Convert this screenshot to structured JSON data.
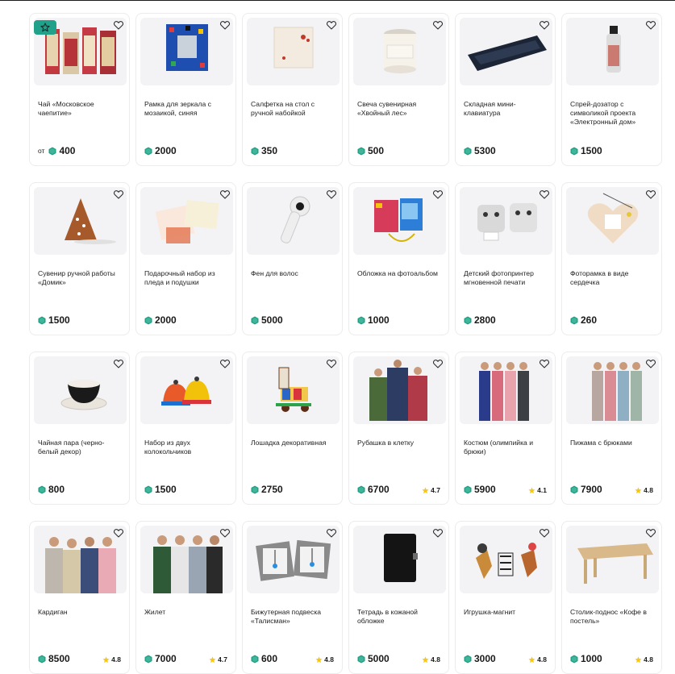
{
  "products": [
    {
      "name": "Чай «Московское чаепитие»",
      "from": "от",
      "price": "400",
      "rating": "",
      "featured": true,
      "image": "tea-boxes-image"
    },
    {
      "name": "Рамка для зеркала с мозаикой, синяя",
      "from": "",
      "price": "2000",
      "rating": "",
      "image": "mosaic-frame-image"
    },
    {
      "name": "Салфетка на стол с ручной набойкой",
      "from": "",
      "price": "350",
      "rating": "",
      "image": "napkin-image"
    },
    {
      "name": "Свеча сувенирная «Хвойный лес»",
      "from": "",
      "price": "500",
      "rating": "",
      "image": "candle-image"
    },
    {
      "name": "Складная мини-клавиатура",
      "from": "",
      "price": "5300",
      "rating": "",
      "image": "keyboard-image"
    },
    {
      "name": "Спрей-дозатор с символикой проекта «Электронный дом»",
      "from": "",
      "price": "1500",
      "rating": "",
      "image": "spray-bottle-image"
    },
    {
      "name": "Сувенир ручной работы «Домик»",
      "from": "",
      "price": "1500",
      "rating": "",
      "image": "house-souvenir-image"
    },
    {
      "name": "Подарочный набор из пледа и подушки",
      "from": "",
      "price": "2000",
      "rating": "",
      "image": "blanket-set-image"
    },
    {
      "name": "Фен для волос",
      "from": "",
      "price": "5000",
      "rating": "",
      "image": "hair-dryer-image"
    },
    {
      "name": "Обложка на фотоальбом",
      "from": "",
      "price": "1000",
      "rating": "",
      "image": "album-cover-image"
    },
    {
      "name": "Детский фотопринтер мгновенной печати",
      "from": "",
      "price": "2800",
      "rating": "",
      "image": "photo-printer-image"
    },
    {
      "name": "Фоторамка в виде сердечка",
      "from": "",
      "price": "260",
      "rating": "",
      "image": "heart-frame-image"
    },
    {
      "name": "Чайная пара (черно-белый декор)",
      "from": "",
      "price": "800",
      "rating": "",
      "image": "teacup-image"
    },
    {
      "name": "Набор из двух колокольчиков",
      "from": "",
      "price": "1500",
      "rating": "",
      "image": "bells-image"
    },
    {
      "name": "Лошадка декоративная",
      "from": "",
      "price": "2750",
      "rating": "",
      "image": "toy-horse-image"
    },
    {
      "name": "Рубашка в клетку",
      "from": "",
      "price": "6700",
      "rating": "4.7",
      "image": "plaid-shirts-image"
    },
    {
      "name": "Костюм (олимпийка и брюки)",
      "from": "",
      "price": "5900",
      "rating": "4.1",
      "image": "tracksuits-image"
    },
    {
      "name": "Пижама с брюками",
      "from": "",
      "price": "7900",
      "rating": "4.8",
      "image": "pajamas-image"
    },
    {
      "name": "Кардиган",
      "from": "",
      "price": "8500",
      "rating": "4.8",
      "image": "cardigans-image"
    },
    {
      "name": "Жилет",
      "from": "",
      "price": "7000",
      "rating": "4.7",
      "image": "vests-image"
    },
    {
      "name": "Бижутерная подвеска «Талисман»",
      "from": "",
      "price": "600",
      "rating": "4.8",
      "image": "pendant-boxes-image"
    },
    {
      "name": "Тетрадь в кожаной обложке",
      "from": "",
      "price": "5000",
      "rating": "4.8",
      "image": "leather-notebook-image"
    },
    {
      "name": "Игрушка-магнит",
      "from": "",
      "price": "3000",
      "rating": "4.8",
      "image": "magnet-toys-image"
    },
    {
      "name": "Столик-поднос «Кофе в постель»",
      "from": "",
      "price": "1000",
      "rating": "4.8",
      "image": "tray-table-image"
    }
  ],
  "colors": {
    "accent": "#21a08a",
    "coin": "#1fa183",
    "star": "#f5c518",
    "card_bg": "#f3f3f5"
  },
  "icons": {
    "favorite": "heart-outline-icon",
    "currency": "coin-icon",
    "rating": "star-icon",
    "featured": "star-badge-icon"
  }
}
